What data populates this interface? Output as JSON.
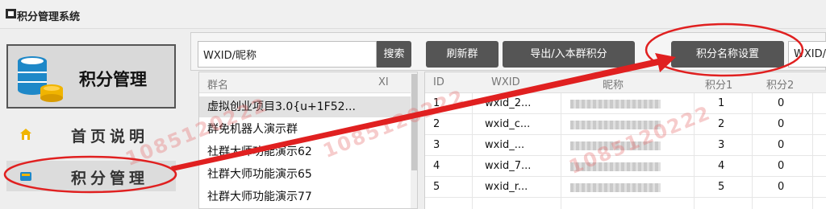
{
  "window": {
    "title": "积分管理系统"
  },
  "sidebar": {
    "logo_text": "积分管理",
    "items": [
      {
        "label": "首页说明",
        "icon": "home-icon"
      },
      {
        "label": "积分管理",
        "icon": "points-icon"
      }
    ]
  },
  "toolbar": {
    "search_value": "WXID/昵称",
    "search_label": "搜索",
    "refresh_label": "刷新群",
    "export_label": "导出/入本群积分",
    "points_name_label": "积分名称设置",
    "secondary_input_value": "WXID/"
  },
  "group_list": {
    "headers": [
      "群名",
      "XI"
    ],
    "rows": [
      "虚拟创业项目3.0{u+1F52...",
      "群免机器人演示群",
      "社群大师功能演示62",
      "社群大师功能演示65",
      "社群大师功能演示77"
    ]
  },
  "member_table": {
    "headers": [
      "ID",
      "WXID",
      "昵称",
      "积分1",
      "积分2"
    ],
    "rows": [
      {
        "id": "1",
        "wxid": "wxid_2...",
        "p1": "1",
        "p2": "0"
      },
      {
        "id": "2",
        "wxid": "wxid_c...",
        "p1": "2",
        "p2": "0"
      },
      {
        "id": "3",
        "wxid": "wxid_...",
        "p1": "3",
        "p2": "0"
      },
      {
        "id": "4",
        "wxid": "wxid_7...",
        "p1": "4",
        "p2": "0"
      },
      {
        "id": "5",
        "wxid": "wxid_r...",
        "p1": "5",
        "p2": "0"
      }
    ]
  },
  "watermark": {
    "text": "1085120222"
  },
  "colors": {
    "accent_button": "#555555",
    "annotation_red": "#e02020",
    "logo_blue": "#1e88c8",
    "logo_gold": "#f0b400"
  }
}
